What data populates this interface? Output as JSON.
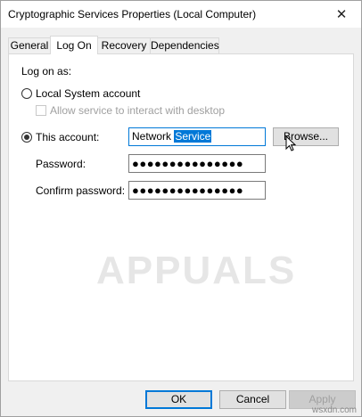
{
  "window": {
    "title": "Cryptographic Services Properties (Local Computer)"
  },
  "tabs": [
    {
      "label": "General"
    },
    {
      "label": "Log On"
    },
    {
      "label": "Recovery"
    },
    {
      "label": "Dependencies"
    }
  ],
  "logon": {
    "heading": "Log on as:",
    "local_system": {
      "label": "Local System account",
      "selected": false
    },
    "interact_desktop": {
      "label": "Allow service to interact with desktop",
      "checked": false,
      "enabled": false
    },
    "this_account": {
      "label": "This account:",
      "selected": true,
      "value_prefix": "Network ",
      "value_selected": "Service",
      "browse_label": "Browse..."
    },
    "password": {
      "label": "Password:",
      "masked": "●●●●●●●●●●●●●●●"
    },
    "confirm_password": {
      "label": "Confirm password:",
      "masked": "●●●●●●●●●●●●●●●"
    }
  },
  "watermark": "APPUALS",
  "buttons": {
    "ok": "OK",
    "cancel": "Cancel",
    "apply": "Apply"
  },
  "site": "wsxdn.com",
  "colors": {
    "selection": "#0078d7",
    "focus_border": "#0078d7"
  },
  "icons": {
    "close": "close-icon",
    "cursor": "mouse-pointer-icon"
  }
}
